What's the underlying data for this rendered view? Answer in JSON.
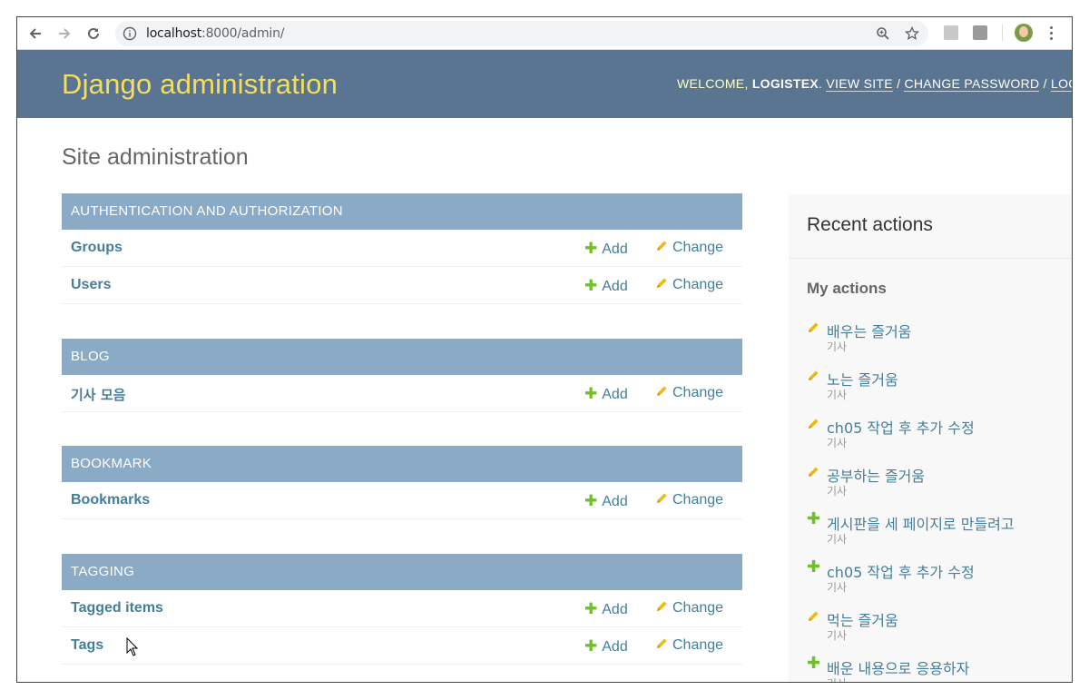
{
  "browser": {
    "url_host": "localhost",
    "url_rest": ":8000/admin/"
  },
  "header": {
    "branding": "Django administration",
    "welcome": "WELCOME, ",
    "username": "LOGISTEX",
    "sep0": ". ",
    "view_site": "VIEW SITE",
    "sep1": " / ",
    "change_password": "CHANGE PASSWORD",
    "sep2": " / ",
    "log_out": "LOG OUT"
  },
  "content": {
    "title": "Site administration",
    "add_label": "Add",
    "change_label": "Change",
    "modules": [
      {
        "caption": "AUTHENTICATION AND AUTHORIZATION",
        "models": [
          "Groups",
          "Users"
        ]
      },
      {
        "caption": "BLOG",
        "models": [
          "기사 모음"
        ]
      },
      {
        "caption": "BOOKMARK",
        "models": [
          "Bookmarks"
        ]
      },
      {
        "caption": "TAGGING",
        "models": [
          "Tagged items",
          "Tags"
        ]
      }
    ]
  },
  "recent": {
    "title": "Recent actions",
    "my_actions": "My actions",
    "items": [
      {
        "action": "change",
        "title": "배우는 즐거움",
        "type": "기사"
      },
      {
        "action": "change",
        "title": "노는 즐거움",
        "type": "기사"
      },
      {
        "action": "change",
        "title": "ch05 작업 후 추가 수정",
        "type": "기사"
      },
      {
        "action": "change",
        "title": "공부하는 즐거움",
        "type": "기사"
      },
      {
        "action": "add",
        "title": "게시판을 세 페이지로 만들려고",
        "type": "기사"
      },
      {
        "action": "add",
        "title": "ch05 작업 후 추가 수정",
        "type": "기사"
      },
      {
        "action": "change",
        "title": "먹는 즐거움",
        "type": "기사"
      },
      {
        "action": "add",
        "title": "배운 내용으로 응용하자",
        "type": "기사"
      }
    ]
  },
  "colors": {
    "header_bg": "#597591",
    "branding": "#f5dd5d",
    "caption_bg": "#8aaac5",
    "link": "#447e9b",
    "add_green": "#70bf2b",
    "change_yellow": "#efb80b"
  }
}
